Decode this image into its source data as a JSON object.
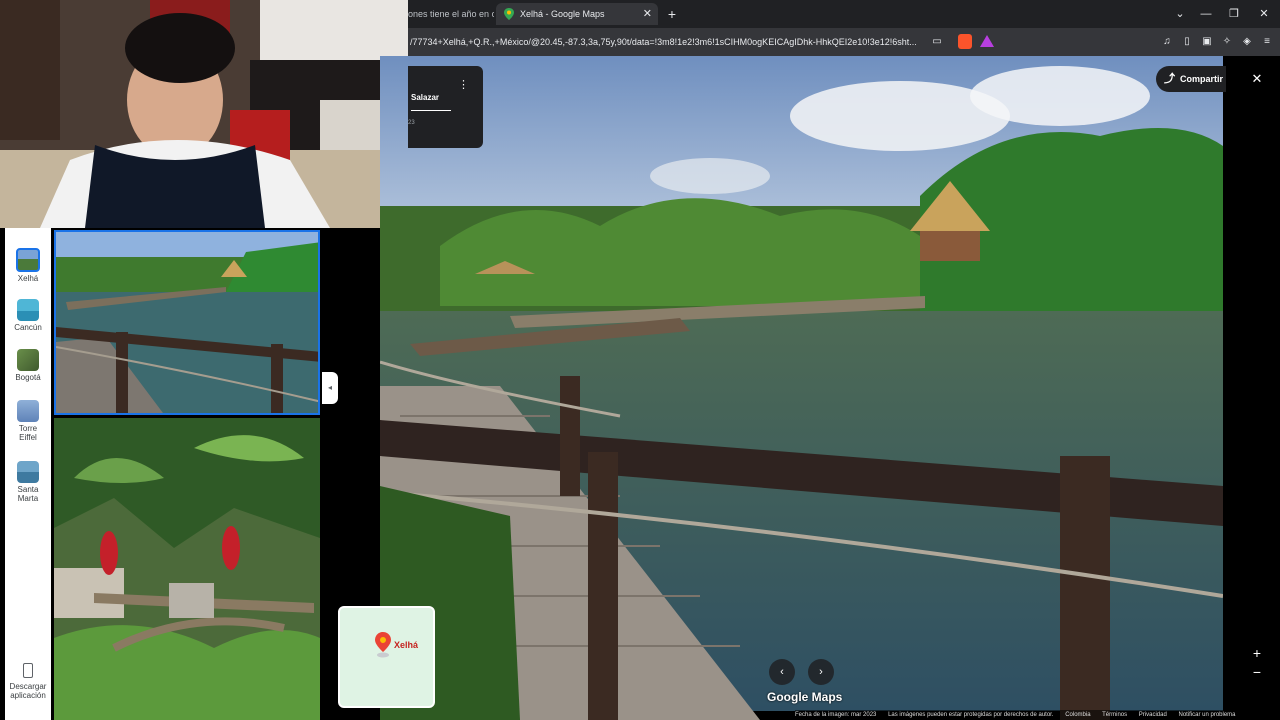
{
  "browser": {
    "inactive_tab_title": "ones tiene el año en co",
    "active_tab_title": "Xelhá - Google Maps",
    "url": "/77734+Xelhá,+Q.R.,+México/@20.45,-87.3,3a,75y,90t/data=!3m8!1e2!3m6!1sCIHM0ogKEICAgIDhk-HhkQEI2e10!3e12!6sht...",
    "new_tab": "+",
    "close_tab": "✕",
    "window_controls": [
      "⌄",
      "—",
      "❐",
      "✕"
    ]
  },
  "streetview": {
    "contributor_name": "Salazar",
    "contributor_sub": "23",
    "menu": "⋮",
    "share_label": "Compartir",
    "close": "✕",
    "zoom_in": "+",
    "zoom_out": "−",
    "prev": "‹",
    "next": "›",
    "logo": "Google Maps",
    "footer": [
      "Fecha de la imagen: mar 2023",
      "Las imágenes pueden estar protegidas por derechos de autor.",
      "Colombia",
      "Términos",
      "Privacidad",
      "Notificar un problema"
    ]
  },
  "minimap": {
    "label": "Xelhá"
  },
  "sidebar": {
    "items": [
      {
        "label": "Xelhá",
        "icon": "xelha-thumb-icon",
        "active": true
      },
      {
        "label": "Cancún",
        "icon": "cancun-thumb-icon"
      },
      {
        "label": "Bogotá",
        "icon": "bogota-thumb-icon"
      },
      {
        "label": "Torre Eiffel",
        "icon": "eiffel-thumb-icon"
      },
      {
        "label": "Santa Marta",
        "icon": "santa-marta-thumb-icon"
      }
    ],
    "download_label": "Descargar aplicación",
    "collapse": "◂"
  },
  "colors": {
    "accent": "#1a73e8",
    "chrome_dark": "#202124",
    "pin": "#ea4335"
  }
}
